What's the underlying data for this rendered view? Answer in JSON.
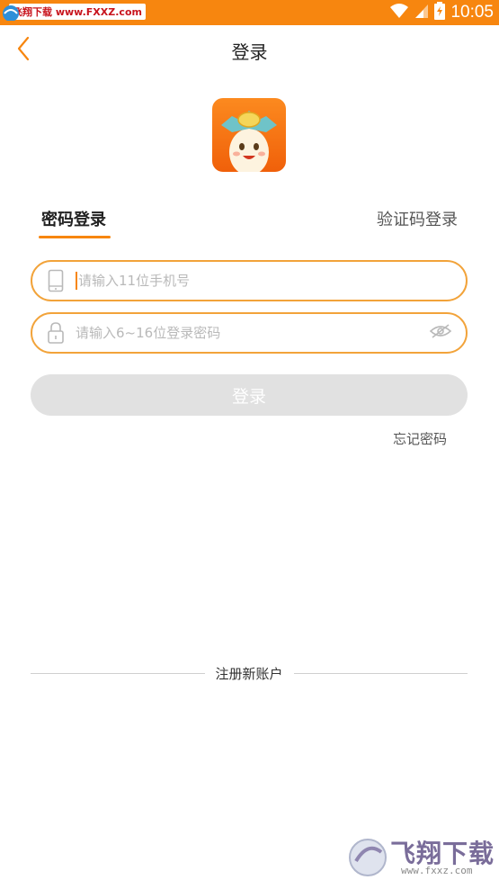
{
  "status_bar": {
    "time": "10:05",
    "watermark_text": "飞翔下载 www.FXXZ.com",
    "colors": {
      "background": "#f7860f"
    }
  },
  "nav": {
    "title": "登录",
    "back_icon": "chevron-left-icon"
  },
  "tabs": [
    {
      "label": "密码登录",
      "active": true
    },
    {
      "label": "验证码登录",
      "active": false
    }
  ],
  "form": {
    "phone": {
      "placeholder": "请输入11位手机号",
      "value": "",
      "icon": "phone-icon"
    },
    "password": {
      "placeholder": "请输入6~16位登录密码",
      "value": "",
      "icon": "lock-icon",
      "toggle_icon": "eye-hidden-icon"
    },
    "login_label": "登录",
    "forgot_label": "忘记密码"
  },
  "register": {
    "label": "注册新账户"
  },
  "watermark_bottom": {
    "title": "飞翔下载",
    "url": "www.fxxz.com"
  },
  "colors": {
    "accent": "#f7860f",
    "field_border": "#f2a33a",
    "button_disabled": "#e1e1e1"
  }
}
